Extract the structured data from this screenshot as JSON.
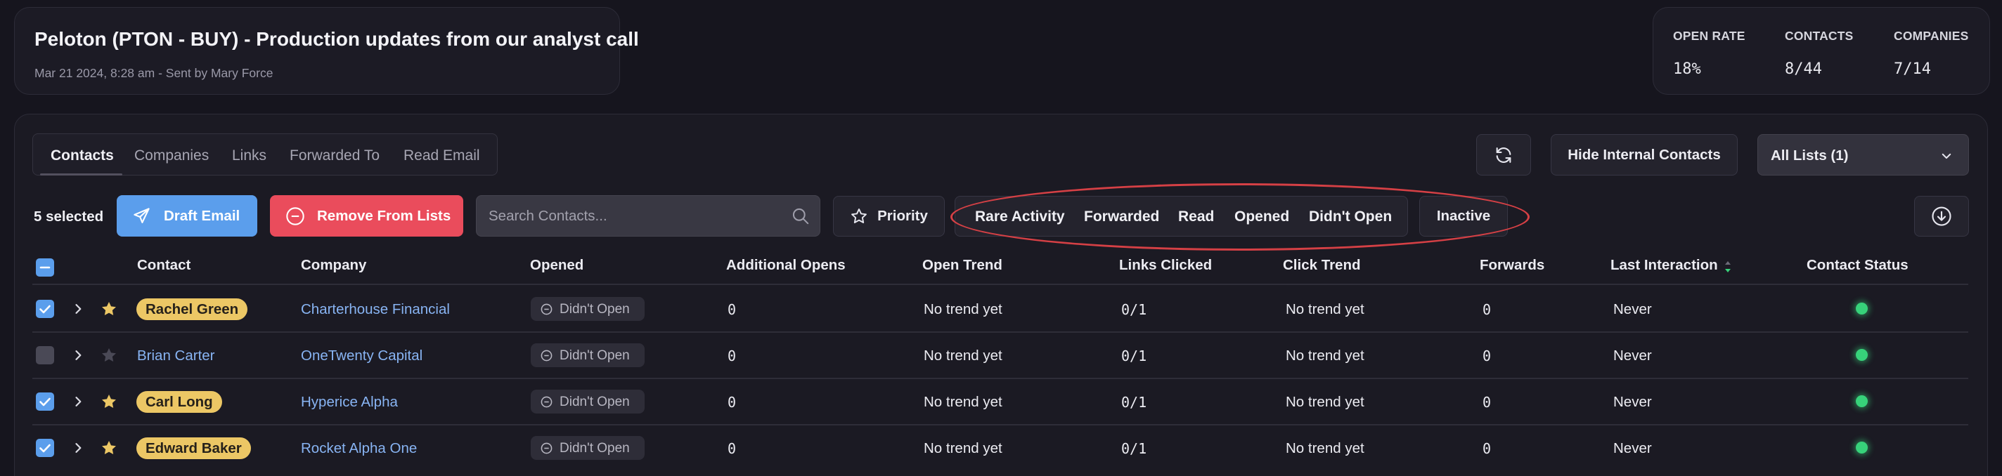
{
  "header": {
    "title": "Peloton (PTON - BUY) - Production updates from our analyst call",
    "subtitle": "Mar 21 2024, 8:28 am - Sent by Mary Force"
  },
  "stats": [
    {
      "label": "OPEN RATE",
      "value": "18%"
    },
    {
      "label": "CONTACTS",
      "value": "8/44"
    },
    {
      "label": "COMPANIES",
      "value": "7/14"
    }
  ],
  "tabs": [
    "Contacts",
    "Companies",
    "Links",
    "Forwarded To",
    "Read Email"
  ],
  "toolbar": {
    "hide_internal": "Hide Internal Contacts",
    "list_select": "All Lists (1)",
    "selected_count": "5 selected",
    "draft_email": "Draft Email",
    "remove_from_lists": "Remove From Lists",
    "search_placeholder": "Search Contacts...",
    "priority": "Priority",
    "filters": [
      "Rare Activity",
      "Forwarded",
      "Read",
      "Opened",
      "Didn't Open"
    ],
    "inactive": "Inactive"
  },
  "table": {
    "columns": [
      "Contact",
      "Company",
      "Opened",
      "Additional Opens",
      "Open Trend",
      "Links Clicked",
      "Click Trend",
      "Forwards",
      "Last Interaction",
      "Contact Status"
    ],
    "rows": [
      {
        "selected": true,
        "starred": true,
        "contact": "Rachel Green",
        "company": "Charterhouse Financial",
        "opened": "Didn't Open",
        "additional_opens": "0",
        "open_trend": "No trend yet",
        "links_clicked": "0/1",
        "click_trend": "No trend yet",
        "forwards": "0",
        "last_interaction": "Never",
        "status": "active"
      },
      {
        "selected": false,
        "starred": false,
        "contact": "Brian Carter",
        "company": "OneTwenty Capital",
        "opened": "Didn't Open",
        "additional_opens": "0",
        "open_trend": "No trend yet",
        "links_clicked": "0/1",
        "click_trend": "No trend yet",
        "forwards": "0",
        "last_interaction": "Never",
        "status": "active"
      },
      {
        "selected": true,
        "starred": true,
        "contact": "Carl Long",
        "company": "Hyperice Alpha",
        "opened": "Didn't Open",
        "additional_opens": "0",
        "open_trend": "No trend yet",
        "links_clicked": "0/1",
        "click_trend": "No trend yet",
        "forwards": "0",
        "last_interaction": "Never",
        "status": "active"
      },
      {
        "selected": true,
        "starred": true,
        "contact": "Edward Baker",
        "company": "Rocket Alpha One",
        "opened": "Didn't Open",
        "additional_opens": "0",
        "open_trend": "No trend yet",
        "links_clicked": "0/1",
        "click_trend": "No trend yet",
        "forwards": "0",
        "last_interaction": "Never",
        "status": "active"
      }
    ]
  },
  "colors": {
    "accent_blue": "#5b9eec",
    "danger_red": "#ea4c5c",
    "star_gold": "#ecc765",
    "status_green": "#37d27a",
    "annotation_red": "#d54045"
  }
}
